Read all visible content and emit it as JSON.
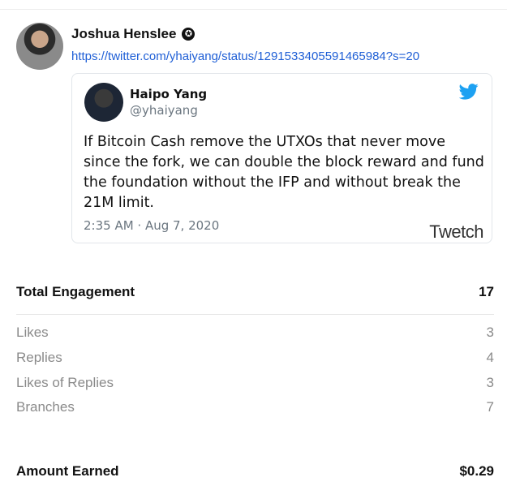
{
  "post": {
    "author_name": "Joshua Henslee",
    "verified_icon": "badge-star-icon",
    "link": "https://twitter.com/yhaiyang/status/1291533405591465984?s=20"
  },
  "tweet": {
    "name": "Haipo Yang",
    "handle": "@yhaiyang",
    "text": "If Bitcoin Cash remove the UTXOs that never move since the fork, we can double the block reward and fund the foundation without the IFP and without break the 21M limit.",
    "time": "2:35 AM · Aug 7, 2020",
    "brand": "Twetch",
    "bird_color": "#1da1f2"
  },
  "engagement": {
    "total_label": "Total Engagement",
    "total_value": "17",
    "items": [
      {
        "label": "Likes",
        "value": "3"
      },
      {
        "label": "Replies",
        "value": "4"
      },
      {
        "label": "Likes of Replies",
        "value": "3"
      },
      {
        "label": "Branches",
        "value": "7"
      }
    ]
  },
  "earnings": {
    "label": "Amount Earned",
    "value": "$0.29"
  }
}
